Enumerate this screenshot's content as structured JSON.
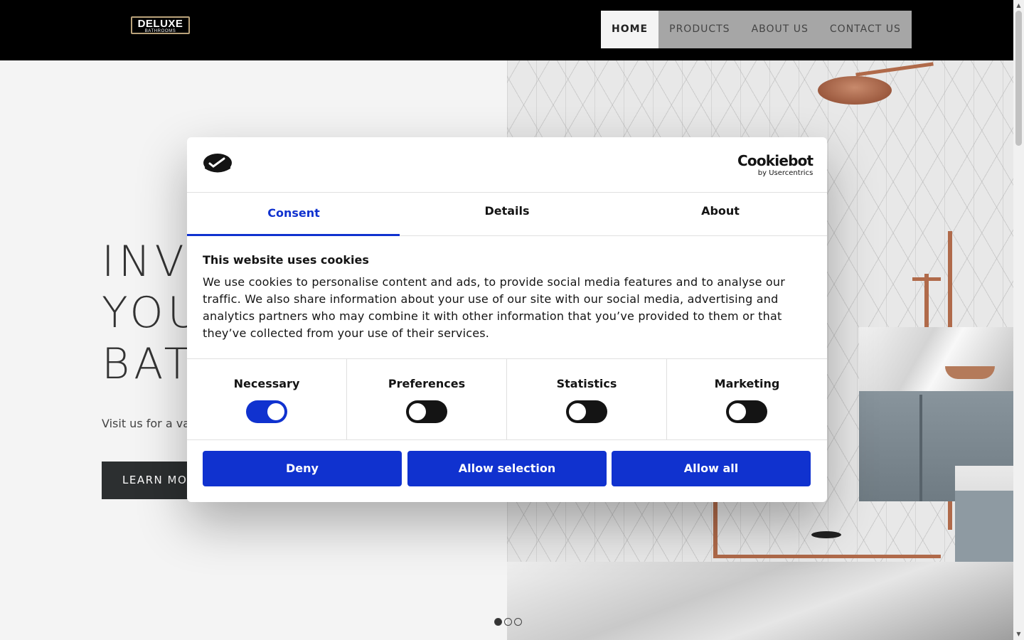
{
  "header": {
    "logo": {
      "main": "DELUXE",
      "sub": "BATHROOMS"
    },
    "nav": [
      {
        "label": "HOME",
        "active": true
      },
      {
        "label": "PRODUCTS",
        "active": false
      },
      {
        "label": "ABOUT US",
        "active": false
      },
      {
        "label": "CONTACT US",
        "active": false
      }
    ]
  },
  "hero": {
    "title_lines": [
      "INV",
      "YOU",
      "BAT"
    ],
    "subtitle": "Visit us for a vari",
    "button_label": "LEARN MO"
  },
  "slider": {
    "count": 3,
    "active_index": 0
  },
  "consent": {
    "brand": {
      "main": "Cookiebot",
      "sub": "by Usercentrics"
    },
    "tabs": [
      {
        "label": "Consent",
        "active": true
      },
      {
        "label": "Details",
        "active": false
      },
      {
        "label": "About",
        "active": false
      }
    ],
    "title": "This website uses cookies",
    "body": "We use cookies to personalise content and ads, to provide social media features and to analyse our traffic. We also share information about your use of our site with our social media, advertising and analytics partners who may combine it with other information that you’ve provided to them or that they’ve collected from your use of their services.",
    "categories": [
      {
        "label": "Necessary",
        "enabled": true
      },
      {
        "label": "Preferences",
        "enabled": false
      },
      {
        "label": "Statistics",
        "enabled": false
      },
      {
        "label": "Marketing",
        "enabled": false
      }
    ],
    "buttons": {
      "deny": "Deny",
      "allow_selection": "Allow selection",
      "allow_all": "Allow all"
    },
    "accent_color": "#1032cf"
  }
}
